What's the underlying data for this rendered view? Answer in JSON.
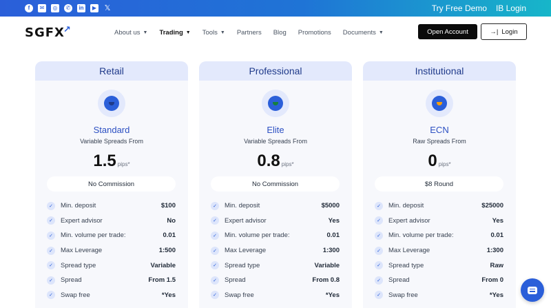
{
  "topbar": {
    "social_icons": [
      "facebook-icon",
      "email-icon",
      "instagram-icon",
      "whatsapp-icon",
      "linkedin-icon",
      "youtube-icon",
      "x-icon"
    ],
    "try_demo": "Try Free Demo",
    "ib_login": "IB Login"
  },
  "nav": {
    "logo": "SGFX",
    "items": [
      {
        "label": "About us",
        "dropdown": true
      },
      {
        "label": "Trading",
        "dropdown": true,
        "active": true
      },
      {
        "label": "Tools",
        "dropdown": true
      },
      {
        "label": "Partners",
        "dropdown": false
      },
      {
        "label": "Blog",
        "dropdown": false
      },
      {
        "label": "Promotions",
        "dropdown": false
      },
      {
        "label": "Documents",
        "dropdown": true
      }
    ],
    "open_account": "Open Account",
    "login": "Login"
  },
  "cards": [
    {
      "category": "Retail",
      "plan": "Standard",
      "spread_desc": "Variable Spreads From",
      "price": "1.5",
      "price_unit": "pips*",
      "commission": "No Commission",
      "badge_color": "#1e3a8a",
      "features": [
        {
          "label": "Min. deposit",
          "value": "$100"
        },
        {
          "label": "Expert advisor",
          "value": "No"
        },
        {
          "label": "Min. volume per trade:",
          "value": "0.01"
        },
        {
          "label": "Max Leverage",
          "value": "1:500"
        },
        {
          "label": "Spread type",
          "value": "Variable"
        },
        {
          "label": "Spread",
          "value": "From 1.5"
        },
        {
          "label": "Swap free",
          "value": "*Yes"
        }
      ]
    },
    {
      "category": "Professional",
      "plan": "Elite",
      "spread_desc": "Variable Spreads From",
      "price": "0.8",
      "price_unit": "pips*",
      "commission": "No Commission",
      "badge_color": "#15803d",
      "features": [
        {
          "label": "Min. deposit",
          "value": "$5000"
        },
        {
          "label": "Expert advisor",
          "value": "Yes"
        },
        {
          "label": "Min. volume per trade:",
          "value": "0.01"
        },
        {
          "label": "Max Leverage",
          "value": "1:300"
        },
        {
          "label": "Spread type",
          "value": "Variable"
        },
        {
          "label": "Spread",
          "value": "From 0.8"
        },
        {
          "label": "Swap free",
          "value": "*Yes"
        }
      ]
    },
    {
      "category": "Institutional",
      "plan": "ECN",
      "spread_desc": "Raw Spreads From",
      "price": "0",
      "price_unit": "pips*",
      "commission": "$8 Round",
      "badge_color": "#f59e0b",
      "features": [
        {
          "label": "Min. deposit",
          "value": "$25000"
        },
        {
          "label": "Expert advisor",
          "value": "Yes"
        },
        {
          "label": "Min. volume per trade:",
          "value": "0.01"
        },
        {
          "label": "Max Leverage",
          "value": "1:300"
        },
        {
          "label": "Spread type",
          "value": "Raw"
        },
        {
          "label": "Spread",
          "value": "From 0"
        },
        {
          "label": "Swap free",
          "value": "*Yes"
        }
      ]
    }
  ],
  "chat": {
    "icon": "chat-icon"
  }
}
